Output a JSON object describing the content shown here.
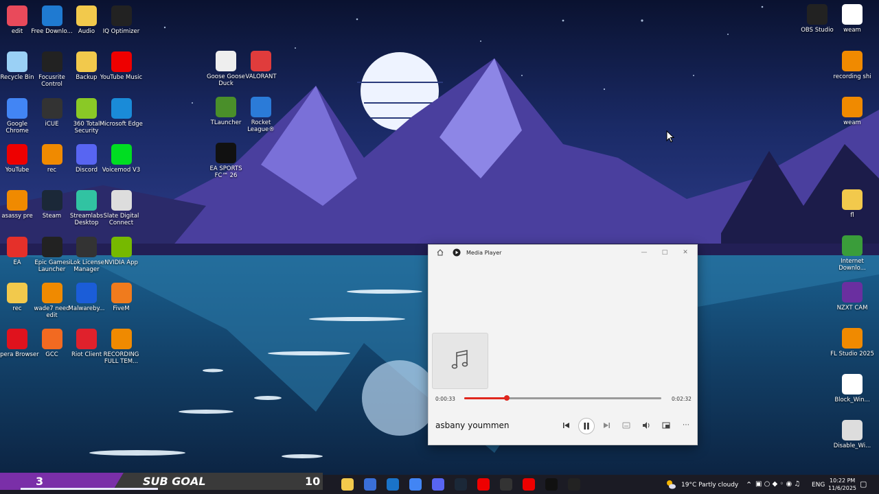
{
  "desktop": {
    "icons_left": [
      {
        "label": "edit",
        "icon": "image-edit-icon",
        "color": "#e94a5b"
      },
      {
        "label": "Free Downlo...",
        "icon": "download-manager-icon",
        "color": "#1f7ad1"
      },
      {
        "label": "Audio",
        "icon": "folder-icon",
        "color": "#f2c94c"
      },
      {
        "label": "IQ Optimizer",
        "icon": "iq-optimizer-icon",
        "color": "#222"
      },
      {
        "label": "Recycle Bin",
        "icon": "recycle-bin-icon",
        "color": "#9ad0f5"
      },
      {
        "label": "Focusrite Control",
        "icon": "focusrite-icon",
        "color": "#222"
      },
      {
        "label": "Backup",
        "icon": "folder-icon",
        "color": "#f2c94c"
      },
      {
        "label": "YouTube Music",
        "icon": "youtube-music-icon",
        "color": "#e00"
      },
      {
        "label": "Google Chrome",
        "icon": "chrome-icon",
        "color": "#4285f4"
      },
      {
        "label": "iCUE",
        "icon": "icue-icon",
        "color": "#333"
      },
      {
        "label": "360 Total Security",
        "icon": "360-security-icon",
        "color": "#8ac926"
      },
      {
        "label": "Microsoft Edge",
        "icon": "edge-icon",
        "color": "#1a8bd8"
      },
      {
        "label": "YouTube",
        "icon": "youtube-icon",
        "color": "#e00"
      },
      {
        "label": "rec",
        "icon": "fl-studio-icon",
        "color": "#f08a00"
      },
      {
        "label": "Discord",
        "icon": "discord-icon",
        "color": "#5865f2"
      },
      {
        "label": "Voicemod V3",
        "icon": "voicemod-icon",
        "color": "#0d2"
      },
      {
        "label": "asassy pre",
        "icon": "fl-studio-icon",
        "color": "#f08a00"
      },
      {
        "label": "Steam",
        "icon": "steam-icon",
        "color": "#1b2838"
      },
      {
        "label": "Streamlabs Desktop",
        "icon": "streamlabs-icon",
        "color": "#31c3a2"
      },
      {
        "label": "Slate Digital Connect",
        "icon": "slate-digital-icon",
        "color": "#ddd"
      },
      {
        "label": "EA",
        "icon": "ea-icon",
        "color": "#e5302a"
      },
      {
        "label": "Epic Games Launcher",
        "icon": "epic-games-icon",
        "color": "#222"
      },
      {
        "label": "iLok License Manager",
        "icon": "ilok-icon",
        "color": "#333"
      },
      {
        "label": "NVIDIA App",
        "icon": "nvidia-icon",
        "color": "#76b900"
      },
      {
        "label": "rec",
        "icon": "folder-icon",
        "color": "#f2c94c"
      },
      {
        "label": "wade7 need edit",
        "icon": "fl-studio-icon",
        "color": "#f08a00"
      },
      {
        "label": "Malwareby...",
        "icon": "malwarebytes-icon",
        "color": "#1b5dd8"
      },
      {
        "label": "FiveM",
        "icon": "fivem-icon",
        "color": "#f07b1d"
      },
      {
        "label": "Opera Browser",
        "icon": "opera-icon",
        "color": "#e0121d"
      },
      {
        "label": "GCC",
        "icon": "gcc-icon",
        "color": "#f26a21"
      },
      {
        "label": "Riot Client",
        "icon": "riot-client-icon",
        "color": "#e0212c"
      },
      {
        "label": "RECORDING FULL TEM...",
        "icon": "fl-studio-icon",
        "color": "#f08a00"
      }
    ],
    "icons_middle": [
      {
        "label": "Goose Goose Duck",
        "icon": "goose-icon",
        "color": "#eee"
      },
      {
        "label": "VALORANT",
        "icon": "valorant-icon",
        "color": "#e03c3c"
      },
      {
        "label": "TLauncher",
        "icon": "minecraft-icon",
        "color": "#4a8f2a"
      },
      {
        "label": "Rocket League®",
        "icon": "rocket-league-icon",
        "color": "#2b7bd8"
      },
      {
        "label": "EA SPORTS FC™ 26",
        "icon": "ea-fc-icon",
        "color": "#111"
      }
    ],
    "icons_right": [
      {
        "label": "OBS Studio",
        "icon": "obs-icon",
        "color": "#222"
      },
      {
        "label": "weam",
        "icon": "media-file-icon",
        "color": "#fff"
      },
      {
        "label": "recording shi",
        "icon": "fl-studio-icon",
        "color": "#f08a00"
      },
      {
        "label": "weam",
        "icon": "fl-studio-icon",
        "color": "#f08a00"
      },
      {
        "label": "fl",
        "icon": "zip-folder-icon",
        "color": "#f2c94c"
      },
      {
        "label": "Internet Downlo...",
        "icon": "internet-download-icon",
        "color": "#3a9d3a"
      },
      {
        "label": "NZXT CAM",
        "icon": "nzxt-icon",
        "color": "#6a2fa0"
      },
      {
        "label": "FL Studio 2025",
        "icon": "fl-studio-icon",
        "color": "#f08a00"
      },
      {
        "label": "Block_Win...",
        "icon": "script-file-icon",
        "color": "#fff"
      },
      {
        "label": "Disable_Wi...",
        "icon": "registry-file-icon",
        "color": "#ddd"
      }
    ]
  },
  "media_player": {
    "title": "Media Player",
    "elapsed": "0:00:33",
    "duration": "0:02:32",
    "progress": 0.217,
    "song": "asbany yoummen",
    "accent": "#e0261d"
  },
  "overlay": {
    "sub_count": "3",
    "goal_label": "SUB GOAL",
    "goal_target": "10"
  },
  "taskbar": {
    "weather": "19°C  Partly cloudy",
    "language": "ENG",
    "time": "10:22 PM",
    "date": "11/6/2025",
    "apps": [
      "file-explorer-icon",
      "calculator-icon",
      "outlook-icon",
      "chrome-icon",
      "discord-icon",
      "steam-icon",
      "youtube-icon",
      "obs-icon",
      "youtube-music-icon",
      "ea-fc-icon",
      "media-player-icon"
    ]
  }
}
